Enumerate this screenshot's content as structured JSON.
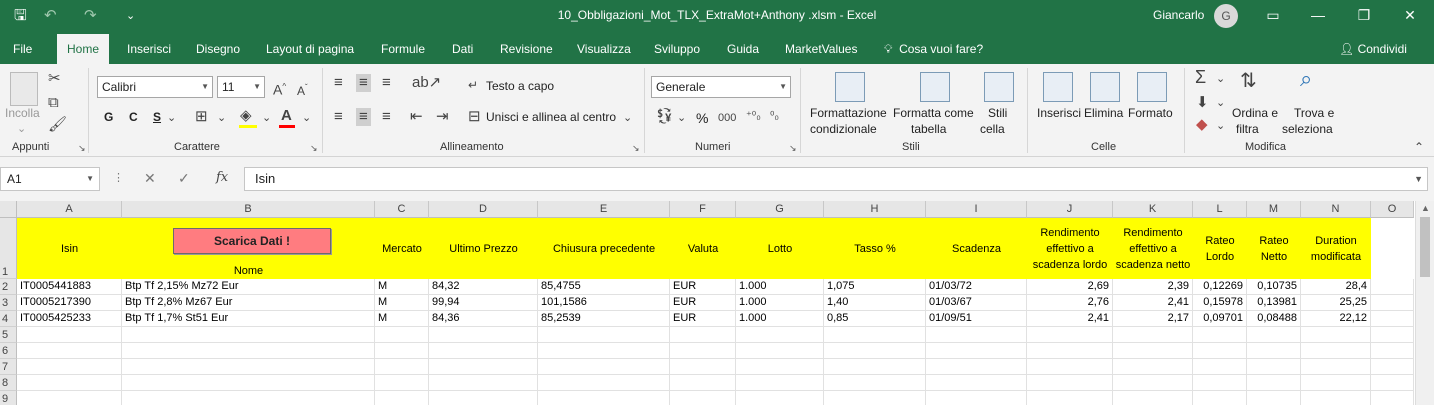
{
  "window": {
    "title": "10_Obbligazioni_Mot_TLX_ExtraMot+Anthony .xlsm  -  Excel",
    "user": "Giancarlo",
    "avatar_initial": "G",
    "accent": "#217346"
  },
  "quick_access": {
    "customize": "⌄"
  },
  "tabs": [
    "File",
    "Home",
    "Inserisci",
    "Disegno",
    "Layout di pagina",
    "Formule",
    "Dati",
    "Revisione",
    "Visualizza",
    "Sviluppo",
    "Guida",
    "MarketValues"
  ],
  "active_tab": "Home",
  "tell_me": "Cosa vuoi fare?",
  "share": "Condividi",
  "ribbon": {
    "clipboard": {
      "paste": "Incolla",
      "label": "Appunti"
    },
    "font": {
      "name": "Calibri",
      "size": "11",
      "bold": "G",
      "italic": "C",
      "underline": "S",
      "label": "Carattere"
    },
    "alignment": {
      "wrap": "Testo a capo",
      "merge": "Unisci e allinea al centro",
      "label": "Allineamento"
    },
    "number": {
      "format": "Generale",
      "percent": "%",
      "thousands": "000",
      "label": "Numeri"
    },
    "styles": {
      "conditional": [
        "Formattazione",
        "condizionale"
      ],
      "table": [
        "Formatta come",
        "tabella"
      ],
      "cell": [
        "Stili",
        "cella"
      ],
      "label": "Stili"
    },
    "cells": {
      "insert": "Inserisci",
      "delete": "Elimina",
      "format": "Formato",
      "label": "Celle"
    },
    "editing": {
      "sort": [
        "Ordina e",
        "filtra"
      ],
      "find": [
        "Trova e",
        "seleziona"
      ],
      "label": "Modifica"
    }
  },
  "formula_bar": {
    "name_box": "A1",
    "fx": "fx",
    "content": "Isin"
  },
  "sheet": {
    "columns": [
      "A",
      "B",
      "C",
      "D",
      "E",
      "F",
      "G",
      "H",
      "I",
      "J",
      "K",
      "L",
      "M",
      "N",
      "O"
    ],
    "rows": [
      "1",
      "2",
      "3",
      "4",
      "5",
      "6",
      "7",
      "8",
      "9"
    ],
    "button": "Scarica Dati !",
    "headers": [
      "Isin",
      "Nome",
      "Mercato",
      "Ultimo Prezzo",
      "Chiusura precedente",
      "Valuta",
      "Lotto",
      "Tasso %",
      "Scadenza",
      "Rendimento effettivo a scadenza lordo",
      "Rendimento effettivo a scadenza netto",
      "Rateo Lordo",
      "Rateo Netto",
      "Duration modificata"
    ],
    "header_fill": "#ffff00",
    "data": [
      [
        "IT0005441883",
        "Btp Tf 2,15% Mz72 Eur",
        "M",
        "84,32",
        "85,4755",
        "EUR",
        "1.000",
        "1,075",
        "01/03/72",
        "2,69",
        "2,39",
        "0,12269",
        "0,10735",
        "28,4"
      ],
      [
        "IT0005217390",
        "Btp Tf 2,8% Mz67 Eur",
        "M",
        "99,94",
        "101,1586",
        "EUR",
        "1.000",
        "1,40",
        "01/03/67",
        "2,76",
        "2,41",
        "0,15978",
        "0,13981",
        "25,25"
      ],
      [
        "IT0005425233",
        "Btp Tf 1,7% St51 Eur",
        "M",
        "84,36",
        "85,2539",
        "EUR",
        "1.000",
        "0,85",
        "01/09/51",
        "2,41",
        "2,17",
        "0,09701",
        "0,08488",
        "22,12"
      ]
    ]
  }
}
